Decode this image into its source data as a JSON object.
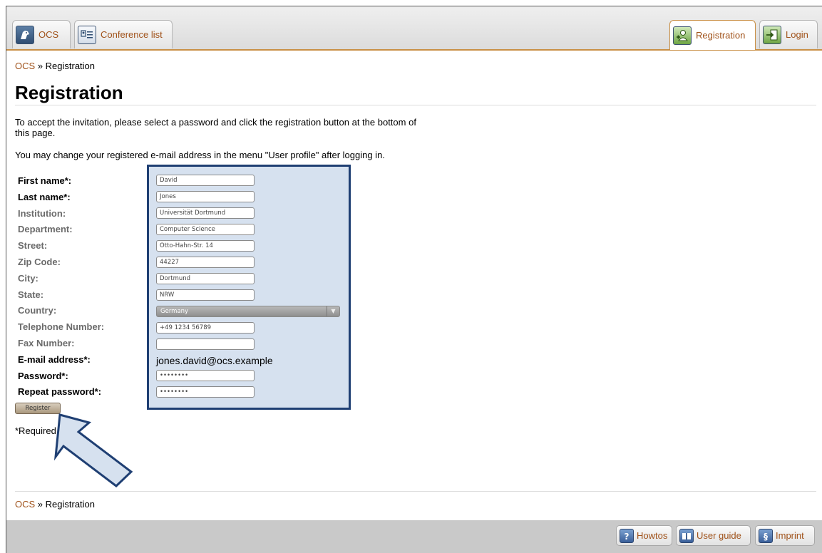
{
  "nav": {
    "tabs_left": [
      {
        "label": "OCS",
        "icon": "ocs-logo-icon"
      },
      {
        "label": "Conference list",
        "icon": "conference-list-icon"
      }
    ],
    "tabs_right": [
      {
        "label": "Registration",
        "icon": "registration-icon",
        "active": true
      },
      {
        "label": "Login",
        "icon": "login-icon"
      }
    ]
  },
  "breadcrumb": {
    "root": "OCS",
    "separator": " » ",
    "current": "Registration"
  },
  "page": {
    "title": "Registration",
    "intro1": "To accept the invitation, please select a password and click the registration button at the bottom of this page.",
    "intro2": "You may change your registered e-mail address in the menu \"User profile\" after logging in."
  },
  "form": {
    "labels": {
      "first_name": "First name*:",
      "last_name": "Last name*:",
      "institution": "Institution:",
      "department": "Department:",
      "street": "Street:",
      "zip": "Zip Code:",
      "city": "City:",
      "state": "State:",
      "country": "Country:",
      "telephone": "Telephone Number:",
      "fax": "Fax Number:",
      "email": "E-mail address*:",
      "password": "Password*:",
      "repeat_password": "Repeat password*:"
    },
    "values": {
      "first_name": "David",
      "last_name": "Jones",
      "institution": "Universität Dortmund",
      "department": "Computer Science",
      "street": "Otto-Hahn-Str. 14",
      "zip": "44227",
      "city": "Dortmund",
      "state": "NRW",
      "country": "Germany",
      "telephone": "+49 1234 56789",
      "fax": "",
      "email": "jones.david@ocs.example",
      "password": "••••••••",
      "repeat_password": "••••••••"
    },
    "register_label": "Register",
    "required_note": "*Required field"
  },
  "footer": {
    "tabs": [
      {
        "label": "Howtos",
        "icon": "help-icon"
      },
      {
        "label": "User guide",
        "icon": "book-icon"
      },
      {
        "label": "Imprint",
        "icon": "section-sign-icon"
      }
    ]
  },
  "colors": {
    "link": "#a0521a",
    "accent_border": "#c98f45",
    "highlight_fill": "#d6e1ef",
    "highlight_border": "#1f3f73"
  }
}
